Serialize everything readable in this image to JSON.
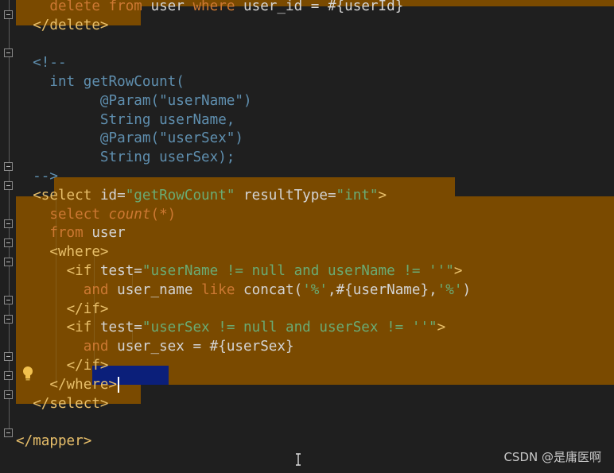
{
  "editor": {
    "lines": [
      {
        "tokens": [
          {
            "t": "    ",
            "c": "c-plain"
          },
          {
            "t": "delete ",
            "c": "c-kw"
          },
          {
            "t": "from ",
            "c": "c-kw"
          },
          {
            "t": "user ",
            "c": "c-plain"
          },
          {
            "t": "where ",
            "c": "c-kw"
          },
          {
            "t": "user_id = #{userId}",
            "c": "c-plain"
          }
        ]
      },
      {
        "tokens": [
          {
            "t": "  ",
            "c": "c-plain"
          },
          {
            "t": "</delete>",
            "c": "c-tag"
          }
        ]
      },
      {
        "tokens": []
      },
      {
        "tokens": [
          {
            "t": "  <!--",
            "c": "c-cmt"
          }
        ]
      },
      {
        "tokens": [
          {
            "t": "    int getRowCount(",
            "c": "c-cmt"
          }
        ]
      },
      {
        "tokens": [
          {
            "t": "          @Param(\"userName\")",
            "c": "c-cmt"
          }
        ]
      },
      {
        "tokens": [
          {
            "t": "          String userName,",
            "c": "c-cmt"
          }
        ]
      },
      {
        "tokens": [
          {
            "t": "          @Param(\"userSex\")",
            "c": "c-cmt"
          }
        ]
      },
      {
        "tokens": [
          {
            "t": "          String userSex);",
            "c": "c-cmt"
          }
        ]
      },
      {
        "tokens": [
          {
            "t": "  -->",
            "c": "c-cmt"
          }
        ]
      },
      {
        "tokens": [
          {
            "t": "  ",
            "c": "c-plain"
          },
          {
            "t": "<select ",
            "c": "c-tag"
          },
          {
            "t": "id=",
            "c": "c-attr"
          },
          {
            "t": "\"getRowCount\"",
            "c": "c-str"
          },
          {
            "t": " resultType=",
            "c": "c-attr"
          },
          {
            "t": "\"int\"",
            "c": "c-str"
          },
          {
            "t": ">",
            "c": "c-tag"
          }
        ]
      },
      {
        "tokens": [
          {
            "t": "    ",
            "c": "c-plain"
          },
          {
            "t": "select ",
            "c": "c-kw"
          },
          {
            "t": "count",
            "c": "c-it"
          },
          {
            "t": "(*)",
            "c": "c-kw"
          }
        ]
      },
      {
        "tokens": [
          {
            "t": "    ",
            "c": "c-plain"
          },
          {
            "t": "from ",
            "c": "c-kw"
          },
          {
            "t": "user",
            "c": "c-plain"
          }
        ]
      },
      {
        "tokens": [
          {
            "t": "    ",
            "c": "c-plain"
          },
          {
            "t": "<where>",
            "c": "c-tag"
          }
        ]
      },
      {
        "tokens": [
          {
            "t": "      ",
            "c": "c-plain"
          },
          {
            "t": "<if ",
            "c": "c-tag"
          },
          {
            "t": "test=",
            "c": "c-attr"
          },
          {
            "t": "\"userName != null and userName != ''\"",
            "c": "c-str"
          },
          {
            "t": ">",
            "c": "c-tag"
          }
        ]
      },
      {
        "tokens": [
          {
            "t": "        ",
            "c": "c-plain"
          },
          {
            "t": "and ",
            "c": "c-kw"
          },
          {
            "t": "user_name ",
            "c": "c-plain"
          },
          {
            "t": "like ",
            "c": "c-kw"
          },
          {
            "t": "concat(",
            "c": "c-fn"
          },
          {
            "t": "'%'",
            "c": "c-str"
          },
          {
            "t": ",#{userName},",
            "c": "c-plain"
          },
          {
            "t": "'%'",
            "c": "c-str"
          },
          {
            "t": ")",
            "c": "c-plain"
          }
        ]
      },
      {
        "tokens": [
          {
            "t": "      ",
            "c": "c-plain"
          },
          {
            "t": "</if>",
            "c": "c-tag"
          }
        ]
      },
      {
        "tokens": [
          {
            "t": "      ",
            "c": "c-plain"
          },
          {
            "t": "<if ",
            "c": "c-tag"
          },
          {
            "t": "test=",
            "c": "c-attr"
          },
          {
            "t": "\"userSex != null and userSex != ''\"",
            "c": "c-str"
          },
          {
            "t": ">",
            "c": "c-tag"
          }
        ]
      },
      {
        "tokens": [
          {
            "t": "        ",
            "c": "c-plain"
          },
          {
            "t": "and ",
            "c": "c-kw"
          },
          {
            "t": "user_sex = #{userSex}",
            "c": "c-plain"
          }
        ]
      },
      {
        "tokens": [
          {
            "t": "      ",
            "c": "c-plain"
          },
          {
            "t": "</if>",
            "c": "c-tag"
          }
        ]
      },
      {
        "tokens": [
          {
            "t": "    ",
            "c": "c-plain"
          },
          {
            "t": "</where>",
            "c": "c-tag"
          }
        ],
        "caret": true
      },
      {
        "tokens": [
          {
            "t": "  ",
            "c": "c-plain"
          },
          {
            "t": "</select>",
            "c": "c-tag"
          }
        ]
      },
      {
        "tokens": []
      },
      {
        "tokens": [
          {
            "t": "</mapper>",
            "c": "c-tag"
          }
        ]
      }
    ]
  },
  "watermark": "CSDN @是庸医啊",
  "icons": {
    "bulb": "lightbulb-icon",
    "fold": "fold-marker-icon",
    "cursor": "text-cursor-icon"
  },
  "colors": {
    "background": "#1f1f1f",
    "highlight": "#7a4a00",
    "selection": "#0b1f7a",
    "tag": "#e8bf6a",
    "string": "#6aab73",
    "comment": "#5f8faf",
    "keyword": "#cc7832"
  }
}
